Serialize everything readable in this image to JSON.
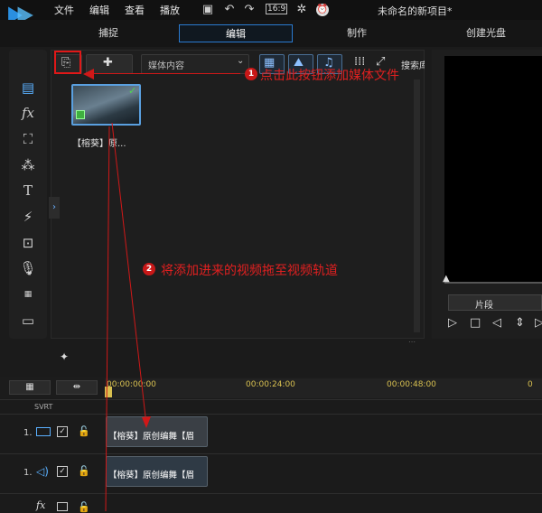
{
  "menu": {
    "items": [
      "文件",
      "编辑",
      "查看",
      "播放"
    ],
    "title": "未命名的新项目*",
    "aspect": "16:9"
  },
  "modes": {
    "tabs": [
      "捕捉",
      "编辑",
      "制作",
      "创建光盘"
    ],
    "active": 1
  },
  "library": {
    "dropdown": "媒体内容",
    "search": "搜索库",
    "clip_label": "【榕葵】原..."
  },
  "annotations": {
    "step1_num": "1",
    "step1_text": "点击此按钮添加媒体文件",
    "step2_num": "2",
    "step2_text": "将添加进来的视频拖至视频轨道"
  },
  "preview": {
    "segment_label": "片段"
  },
  "timeline": {
    "times": [
      "00:00:00:00",
      "00:00:24:00",
      "00:00:48:00"
    ],
    "svrt": "SVRT",
    "tracks": [
      {
        "label": "1."
      },
      {
        "label": "1."
      }
    ],
    "fx_label": "fx",
    "clip_video": "【榕葵】原创编舞【眉",
    "clip_audio": "【榕葵】原创编舞【眉"
  }
}
